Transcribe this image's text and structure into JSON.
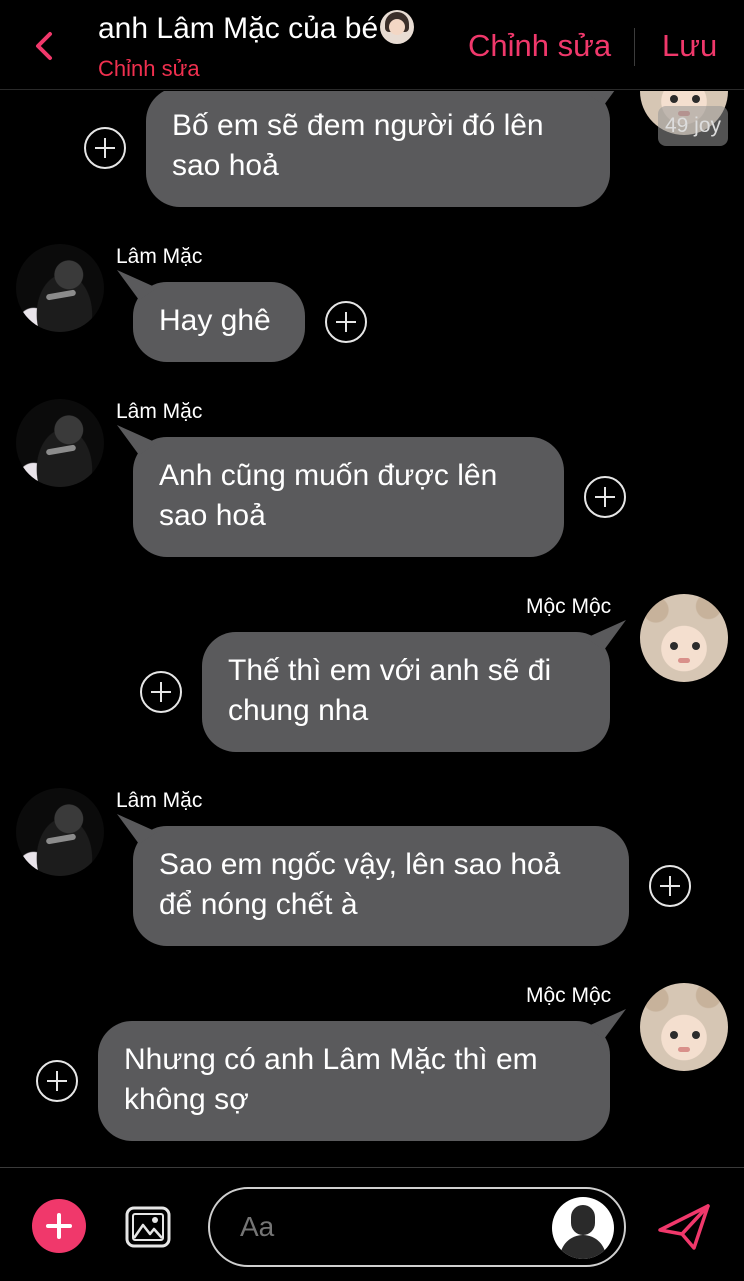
{
  "header": {
    "title": "anh Lâm Mặc của bé",
    "title_emoji": "woman-face-emoji",
    "subtitle": "Chỉnh sửa",
    "edit_label": "Chỉnh sửa",
    "save_label": "Lưu",
    "back_icon": "chevron-left-icon",
    "accent_color": "#f0386b"
  },
  "timestamp_badge": "49 joy",
  "messages": [
    {
      "side": "right",
      "sender": "",
      "text_lines": [
        "Bố em sẽ đem người đó lên",
        "sao hoả"
      ]
    },
    {
      "side": "left",
      "sender": "Lâm Mặc",
      "text_lines": [
        "Hay ghê"
      ]
    },
    {
      "side": "left",
      "sender": "Lâm Mặc",
      "text_lines": [
        "Anh cũng muốn được lên",
        "sao hoả"
      ]
    },
    {
      "side": "right",
      "sender": "Mộc Mộc",
      "text_lines": [
        "Thế thì em với anh sẽ đi",
        "chung nha"
      ]
    },
    {
      "side": "left",
      "sender": "Lâm Mặc",
      "text_lines": [
        "Sao em ngốc vậy, lên sao hoả",
        "để nóng chết à"
      ]
    },
    {
      "side": "right",
      "sender": "Mộc Mộc",
      "text_lines": [
        "Nhưng có anh Lâm Mặc thì em",
        "không sợ"
      ]
    }
  ],
  "composer": {
    "placeholder": "Aa",
    "plus_icon": "plus-icon",
    "gallery_icon": "image-icon",
    "send_icon": "send-icon"
  }
}
